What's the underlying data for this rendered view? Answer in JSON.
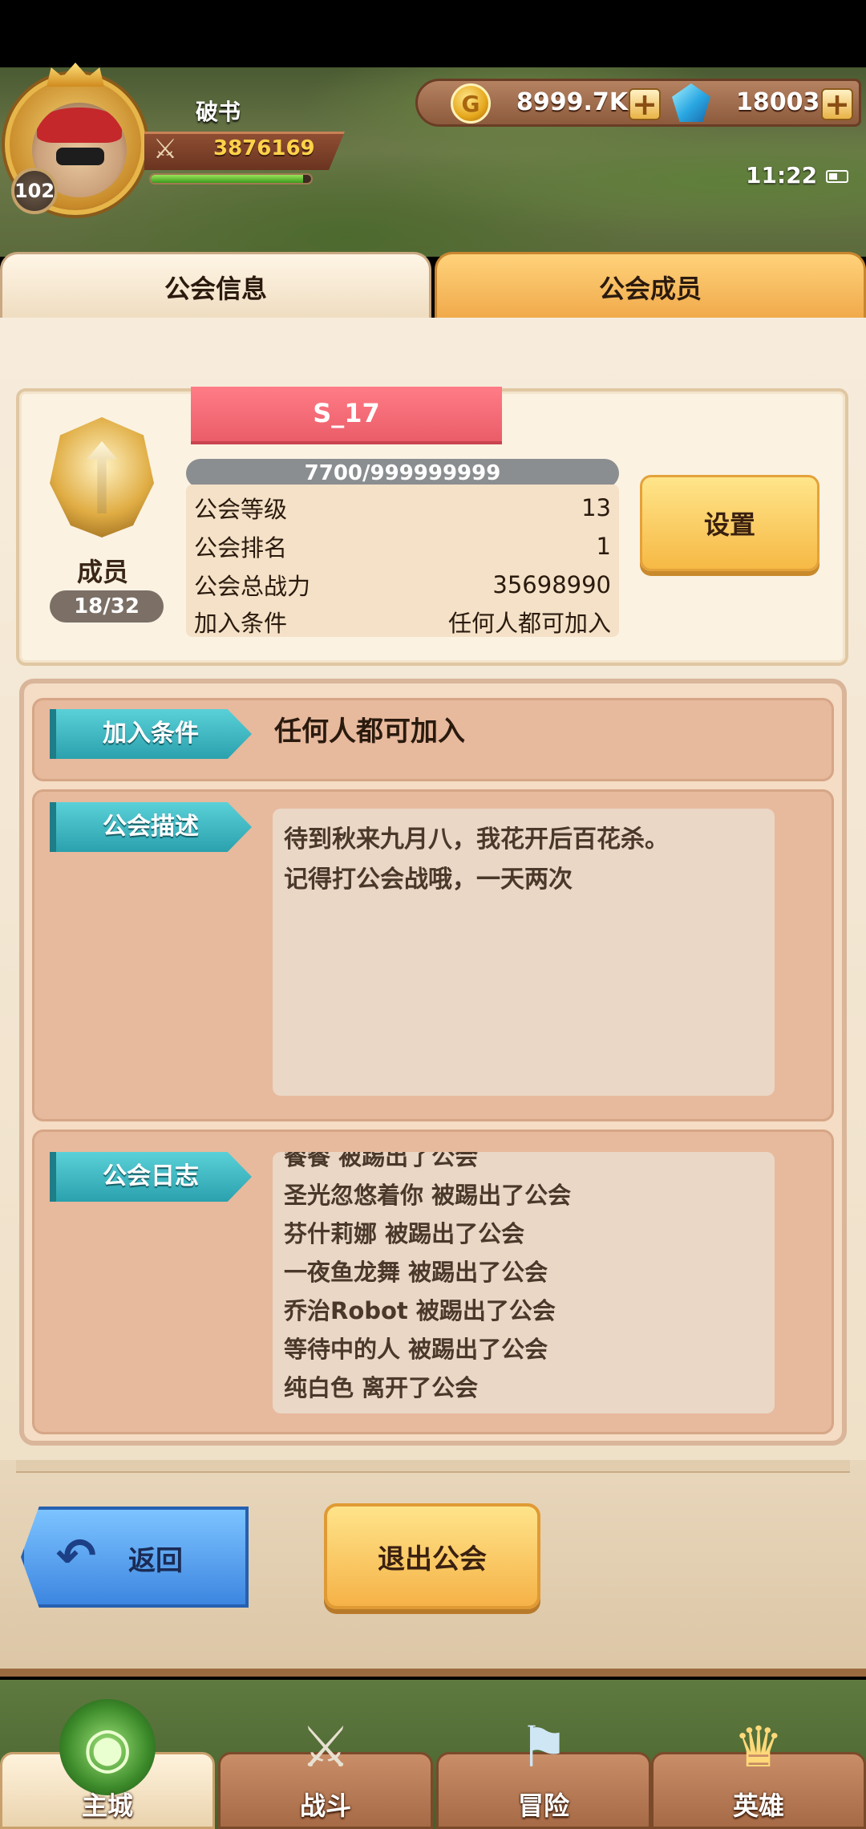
{
  "player": {
    "name": "破书",
    "level": "102",
    "power": "3876169",
    "exp_progress": 0.95
  },
  "resources": {
    "coins": "8999.7K",
    "gems": "18003",
    "plus": "+"
  },
  "clock": "11:22",
  "tabs": [
    "公会信息",
    "公会成员"
  ],
  "guild": {
    "name": "S_17",
    "members_label": "成员",
    "members_count": "18/32",
    "exp": "7700/999999999",
    "stats": [
      {
        "label": "公会等级",
        "value": "13"
      },
      {
        "label": "公会排名",
        "value": "1"
      },
      {
        "label": "公会总战力",
        "value": "35698990"
      },
      {
        "label": "加入条件",
        "value": "任何人都可加入"
      }
    ],
    "settings_label": "设置"
  },
  "sections": {
    "join": {
      "title": "加入条件",
      "value": "任何人都可加入"
    },
    "description": {
      "title": "公会描述",
      "lines": [
        "待到秋来九月八，我花开后百花杀。",
        "记得打公会战哦，一天两次"
      ]
    },
    "log": {
      "title": "公会日志",
      "entries": [
        "餐餐 被踢出了公会",
        "圣光忽悠着你 被踢出了公会",
        "芬什莉娜 被踢出了公会",
        "一夜鱼龙舞 被踢出了公会",
        "乔治Robot 被踢出了公会",
        "等待中的人 被踢出了公会",
        "纯白色 离开了公会"
      ]
    }
  },
  "buttons": {
    "back": "返回",
    "leave": "退出公会"
  },
  "nav": [
    {
      "label": "主城",
      "icon": "castle-icon",
      "active": true
    },
    {
      "label": "战斗",
      "icon": "crossed-swords-icon",
      "active": false
    },
    {
      "label": "冒险",
      "icon": "scroll-map-icon",
      "active": false
    },
    {
      "label": "英雄",
      "icon": "hero-crest-icon",
      "active": false
    }
  ],
  "colors": {
    "tab_active": "#f0a94a",
    "name_banner": "#ea5d69",
    "ribbon": "#2aa1ad",
    "back_button": "#3d86e0",
    "primary_button": "#f5b247"
  }
}
